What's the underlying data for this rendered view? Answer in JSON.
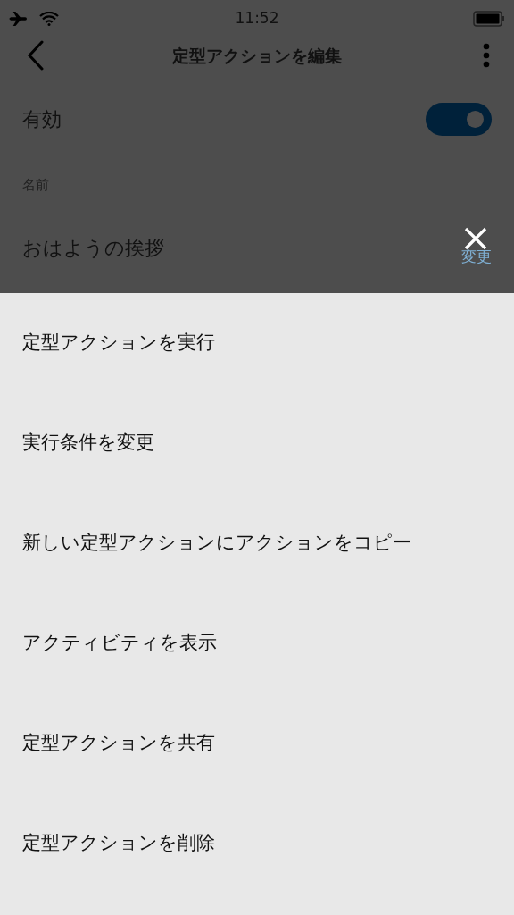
{
  "status_bar": {
    "time": "11:52"
  },
  "header": {
    "title": "定型アクションを編集"
  },
  "enabled": {
    "label": "有効",
    "on": true
  },
  "name": {
    "label": "名前",
    "value": "おはようの挨拶",
    "change_link": "変更"
  },
  "menu": {
    "items": [
      {
        "label": "定型アクションを実行"
      },
      {
        "label": "実行条件を変更"
      },
      {
        "label": "新しい定型アクションにアクションをコピー"
      },
      {
        "label": "アクティビティを表示"
      },
      {
        "label": "定型アクションを共有"
      },
      {
        "label": "定型アクションを削除"
      }
    ]
  }
}
